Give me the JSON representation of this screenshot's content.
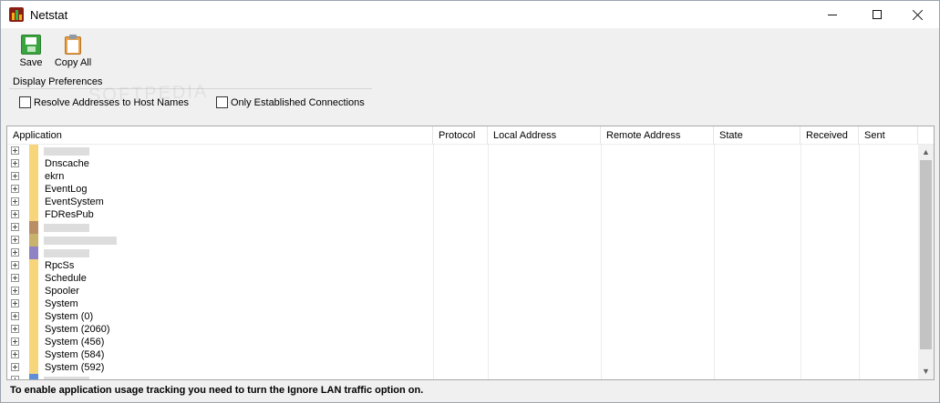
{
  "window": {
    "title": "Netstat"
  },
  "toolbar": {
    "save_label": "Save",
    "copy_all_label": "Copy All"
  },
  "preferences": {
    "group_label": "Display Preferences",
    "resolve_label": "Resolve Addresses to Host Names",
    "resolve_checked": false,
    "established_label": "Only Established Connections",
    "established_checked": false,
    "watermark": "SOFTPEDIA"
  },
  "table": {
    "columns": [
      "Application",
      "Protocol",
      "Local Address",
      "Remote Address",
      "State",
      "Received",
      "Sent"
    ],
    "rows": [
      {
        "label": "",
        "redacted": true,
        "stripe": "#f6d57b"
      },
      {
        "label": "Dnscache",
        "redacted": false,
        "stripe": "#f6d57b"
      },
      {
        "label": "ekrn",
        "redacted": false,
        "stripe": "#f6d57b"
      },
      {
        "label": "EventLog",
        "redacted": false,
        "stripe": "#f6d57b"
      },
      {
        "label": "EventSystem",
        "redacted": false,
        "stripe": "#f6d57b"
      },
      {
        "label": "FDResPub",
        "redacted": false,
        "stripe": "#f6d57b"
      },
      {
        "label": "",
        "redacted": true,
        "stripe": "#b98e64"
      },
      {
        "label": "",
        "redacted": true,
        "stripe": "#c8b26c"
      },
      {
        "label": "",
        "redacted": true,
        "stripe": "#8f83c3"
      },
      {
        "label": "RpcSs",
        "redacted": false,
        "stripe": "#f6d57b"
      },
      {
        "label": "Schedule",
        "redacted": false,
        "stripe": "#f6d57b"
      },
      {
        "label": "Spooler",
        "redacted": false,
        "stripe": "#f6d57b"
      },
      {
        "label": "System",
        "redacted": false,
        "stripe": "#f6d57b"
      },
      {
        "label": "System (0)",
        "redacted": false,
        "stripe": "#f6d57b"
      },
      {
        "label": "System (2060)",
        "redacted": false,
        "stripe": "#f6d57b"
      },
      {
        "label": "System (456)",
        "redacted": false,
        "stripe": "#f6d57b"
      },
      {
        "label": "System (584)",
        "redacted": false,
        "stripe": "#f6d57b"
      },
      {
        "label": "System (592)",
        "redacted": false,
        "stripe": "#f6d57b"
      },
      {
        "label": "",
        "redacted": true,
        "stripe": "#5f8fd8"
      }
    ]
  },
  "status": {
    "message": "To enable application usage tracking you need to turn the Ignore LAN traffic option on."
  }
}
